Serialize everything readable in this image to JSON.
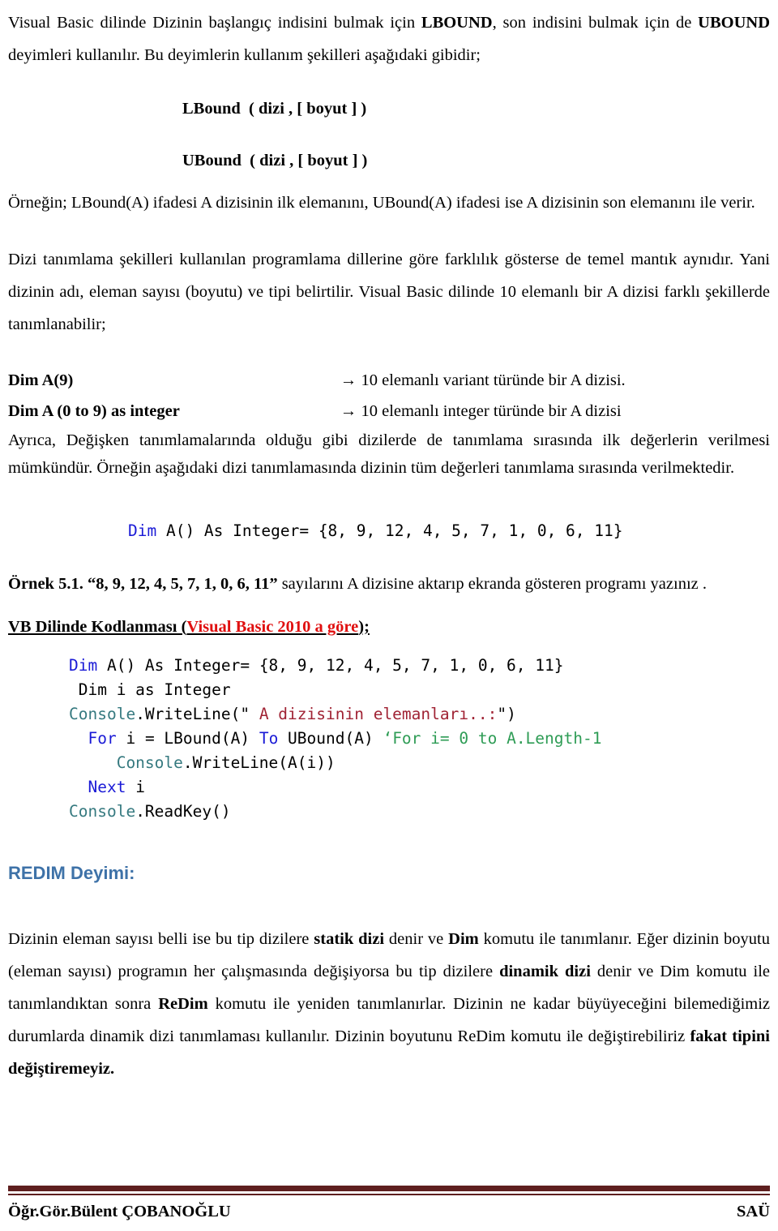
{
  "document": {
    "intro_paragraph_1": "Visual Basic dilinde Dizinin başlangıç indisini bulmak için ",
    "intro_bold_1": "LBOUND",
    "intro_paragraph_2": ", son indisini bulmak için de ",
    "intro_bold_2": "UBOUND",
    "intro_paragraph_3": " deyimleri kullanılır. Bu deyimlerin kullanım şekilleri aşağıdaki gibidir;"
  },
  "syntax": {
    "lbound": "LBound  ( dizi , [ boyut ] )",
    "ubound": "UBound  ( dizi , [ boyut ] )",
    "explanation": "Örneğin; LBound(A) ifadesi A dizisinin ilk elemanını, UBound(A) ifadesi ise A dizisinin son elemanını ile verir."
  },
  "definition": {
    "paragraph": "Dizi tanımlama şekilleri kullanılan programlama dillerine göre farklılık gösterse de temel mantık aynıdır. Yani dizinin adı, eleman sayısı (boyutu) ve tipi belirtilir. Visual Basic dilinde 10 elemanlı bir A dizisi farklı şekillerde tanımlanabilir;",
    "rows": [
      {
        "declaration": "Dim A(9)",
        "arrow": "→",
        "description": "10 elemanlı variant türünde bir A dizisi."
      },
      {
        "declaration": "Dim A (0 to 9) as integer",
        "arrow": "→",
        "description": "10 elemanlı integer türünde bir A dizisi"
      }
    ],
    "paragraph_after": "Ayrıca, Değişken tanımlamalarında olduğu gibi dizilerde de tanımlama sırasında ilk değerlerin verilmesi mümkündür. Örneğin aşağıdaki dizi tanımlamasında dizinin tüm değerleri tanımlama sırasında verilmektedir."
  },
  "sample_declaration": {
    "keyword": "Dim",
    "rest": " A() As Integer= {8, 9, 12, 4, 5, 7, 1, 0, 6, 11}"
  },
  "example": {
    "label": "Örnek 5.1.",
    "numbers_quoted": "“8, 9, 12, 4, 5, 7, 1, 0, 6, 11”",
    "text": " sayılarını A dizisine aktarıp ekranda gösteren programı yazınız .",
    "section_heading_plain_1": "VB Dilinde Kodlanması (",
    "section_heading_red": "Visual Basic 2010 a göre",
    "section_heading_plain_2": ");"
  },
  "code": {
    "line1_kw": "Dim",
    "line1_rest": " A() As Integer= {8, 9, 12, 4, 5, 7, 1, 0, 6, 11}",
    "line2": " Dim i as Integer",
    "line3_type": "Console",
    "line3_mid": ".WriteLine(\"",
    "line3_str": " A dizisinin elemanları..:",
    "line3_end": "\")",
    "line4_indent": "  ",
    "line4_kw1": "For",
    "line4_mid1": " i = LBound(A) ",
    "line4_kw2": "To",
    "line4_mid2": " UBound(A) ",
    "line4_cmt": "‘For i= 0 to A.Length-1",
    "line5_indent": "     ",
    "line5_type": "Console",
    "line5_rest": ".WriteLine(A(i))",
    "line6_indent": "  ",
    "line6_kw": "Next",
    "line6_rest": " i",
    "line7_type": "Console",
    "line7_rest": ".ReadKey()"
  },
  "redim": {
    "heading": "REDIM Deyimi:",
    "p1_a": "Dizinin eleman sayısı belli ise bu tip dizilere ",
    "p1_b_bold": "statik dizi",
    "p1_c": " denir ve ",
    "p1_d_bold": "Dim",
    "p1_e": " komutu ile tanımlanır. Eğer dizinin boyutu (eleman sayısı) programın her çalışmasında değişiyorsa bu tip dizilere ",
    "p1_f_bold": "dinamik dizi",
    "p1_g": " denir ve Dim komutu ile tanımlandıktan sonra ",
    "p1_h_bold": "ReDim",
    "p1_i": " komutu ile yeniden tanımlanırlar. Dizinin ne kadar büyüyeceğini bilemediğimiz durumlarda dinamik dizi tanımlaması kullanılır. Dizinin boyutunu ReDim komutu ile değiştirebiliriz ",
    "p1_j_bold": "fakat tipini değiştiremeyiz."
  },
  "footer": {
    "left": "Öğr.Gör.Bülent ÇOBANOĞLU",
    "right": "SAÜ"
  },
  "colors": {
    "keyword_blue": "#1a1aD6",
    "type_teal": "#35797F",
    "string_red": "#A02334",
    "comment_green": "#2E9C55",
    "heading_blue": "#3E72A8",
    "accent_red": "#E01010",
    "footer_rule": "#5E1F1F"
  }
}
